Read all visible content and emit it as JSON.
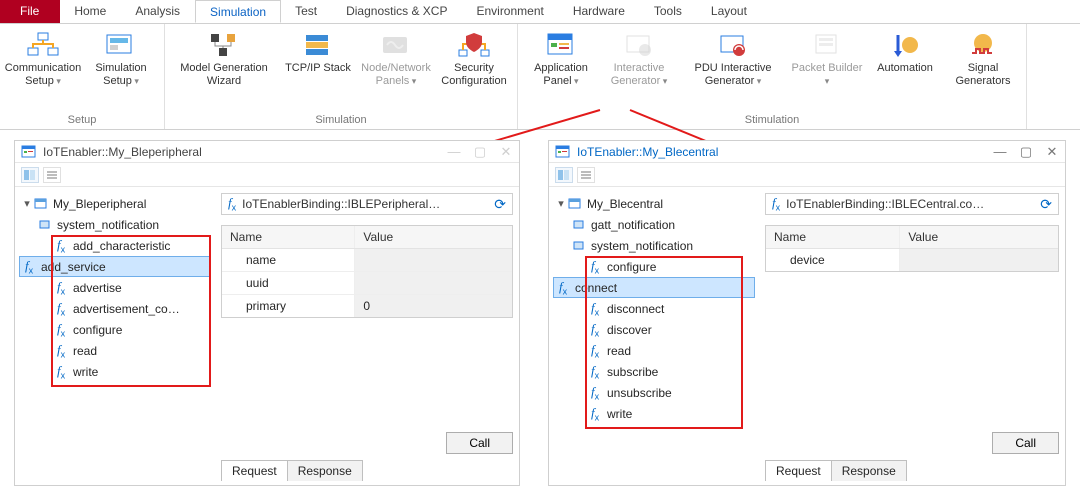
{
  "tabs": {
    "file": "File",
    "items": [
      "Home",
      "Analysis",
      "Simulation",
      "Test",
      "Diagnostics & XCP",
      "Environment",
      "Hardware",
      "Tools",
      "Layout"
    ],
    "active": "Simulation"
  },
  "ribbon": {
    "group_setup": "Setup",
    "group_simulation": "Simulation",
    "group_stimulation": "Stimulation",
    "comm_setup": "Communication Setup",
    "sim_setup": "Simulation Setup",
    "mg_wizard": "Model Generation Wizard",
    "tcpip": "TCP/IP Stack",
    "node_panels": "Node/Network Panels",
    "sec_cfg": "Security Configuration",
    "app_panel": "Application Panel",
    "int_gen": "Interactive Generator",
    "pdu_gen": "PDU Interactive Generator",
    "pkt_build": "Packet Builder",
    "automation": "Automation",
    "sig_gen": "Signal Generators",
    "drop": " ▾"
  },
  "panel_left": {
    "title": "IoTEnabler::My_Bleperipheral",
    "root": "My_Bleperipheral",
    "sys_notif": "system_notification",
    "fns": [
      "add_characteristic",
      "add_service",
      "advertise",
      "advertisement_co…",
      "configure",
      "read",
      "write"
    ],
    "selected": "add_service",
    "breadcrumb": "IoTEnablerBinding::IBLEPeripheral…",
    "params": {
      "head_name": "Name",
      "head_value": "Value",
      "rows": [
        {
          "name": "name",
          "value": ""
        },
        {
          "name": "uuid",
          "value": ""
        },
        {
          "name": "primary",
          "value": "0"
        }
      ]
    },
    "call": "Call",
    "tab_req": "Request",
    "tab_res": "Response"
  },
  "panel_right": {
    "title": "IoTEnabler::My_Blecentral",
    "root": "My_Blecentral",
    "gatt_notif": "gatt_notification",
    "sys_notif": "system_notification",
    "fns": [
      "configure",
      "connect",
      "disconnect",
      "discover",
      "read",
      "subscribe",
      "unsubscribe",
      "write"
    ],
    "selected": "connect",
    "breadcrumb": "IoTEnablerBinding::IBLECentral.co…",
    "params": {
      "head_name": "Name",
      "head_value": "Value",
      "rows": [
        {
          "name": "device",
          "value": ""
        }
      ]
    },
    "call": "Call",
    "tab_req": "Request",
    "tab_res": "Response"
  },
  "icons": {
    "min": "—",
    "max": "▢",
    "close": "✕",
    "link": "⟳"
  }
}
